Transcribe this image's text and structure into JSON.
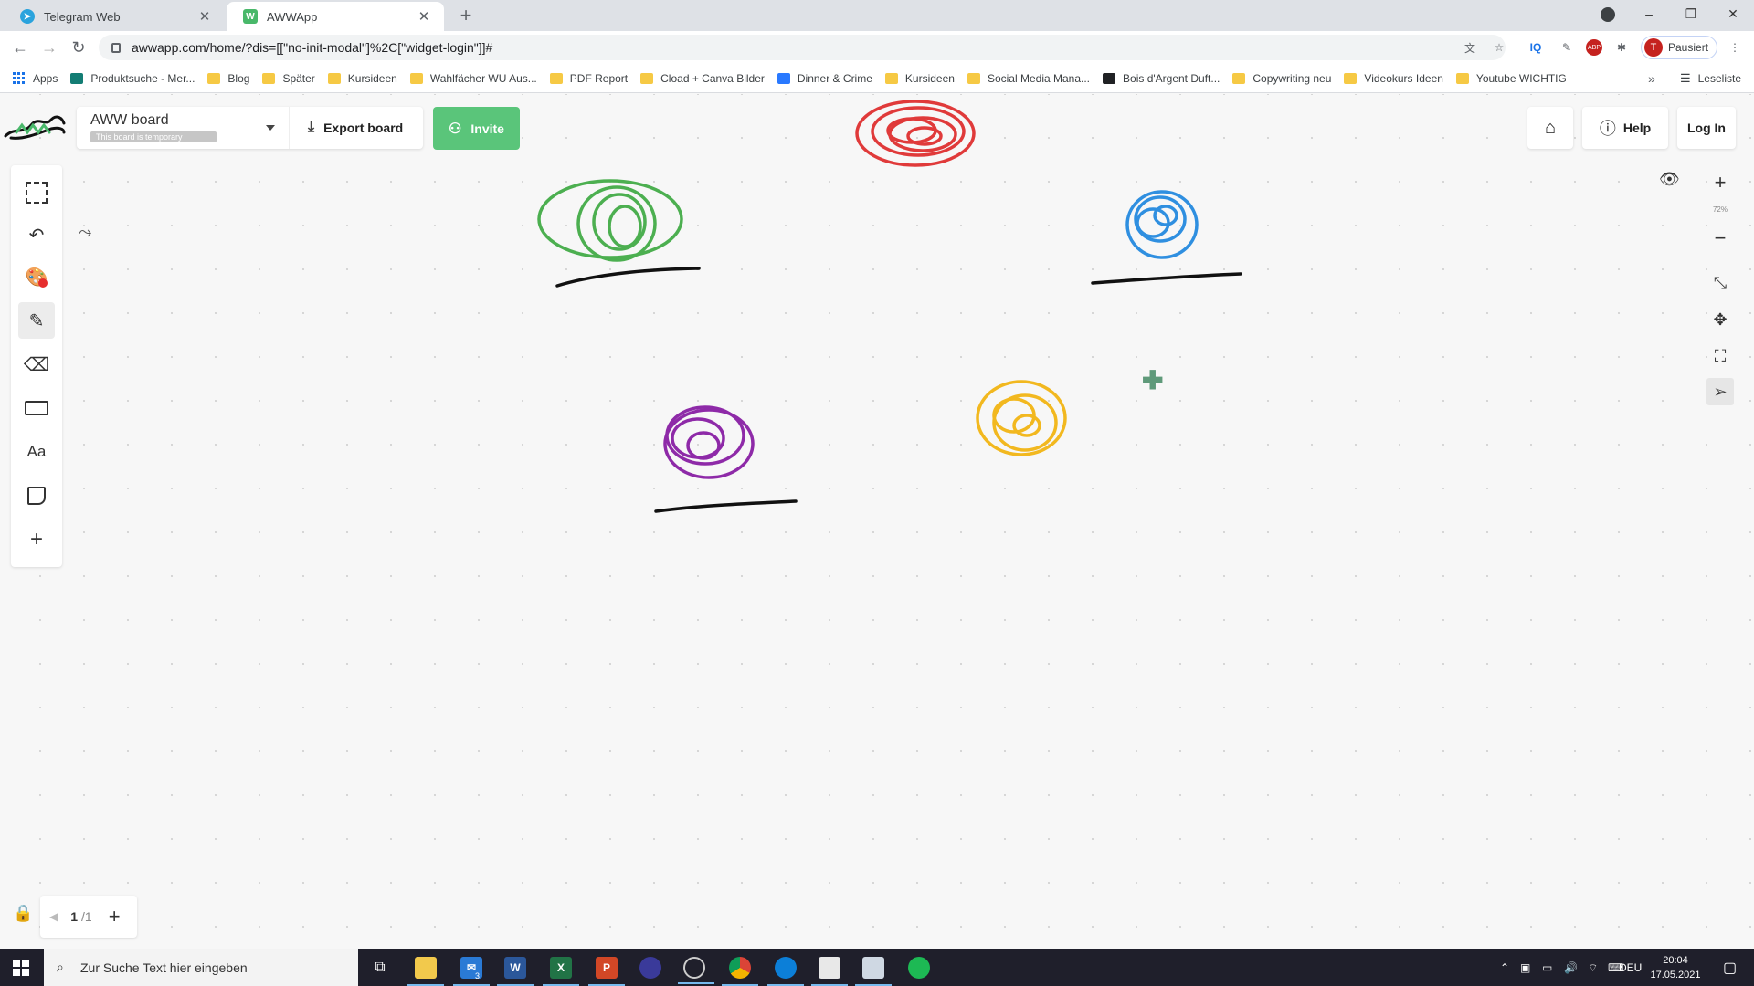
{
  "browser": {
    "tabs": [
      {
        "title": "Telegram Web",
        "active": false
      },
      {
        "title": "AWWApp",
        "active": true
      }
    ],
    "new_tab": "+",
    "url": "awwapp.com/home/?dis=[[\"no-init-modal\"]%2C[\"widget-login\"]]#",
    "window_controls": {
      "minimize": "–",
      "restore": "❐",
      "close": "✕"
    },
    "profile": {
      "initial": "T",
      "label": "Pausiert"
    },
    "bookmarks": [
      {
        "label": "Apps",
        "icon": "apps-grid-icon"
      },
      {
        "label": "Produktsuche - Mer...",
        "icon": "teal-site-icon"
      },
      {
        "label": "Blog",
        "icon": "folder-icon"
      },
      {
        "label": "Später",
        "icon": "folder-icon"
      },
      {
        "label": "Kursideen",
        "icon": "folder-icon"
      },
      {
        "label": "Wahlfächer WU Aus...",
        "icon": "folder-icon"
      },
      {
        "label": "PDF Report",
        "icon": "folder-icon"
      },
      {
        "label": "Cload + Canva Bilder",
        "icon": "folder-icon"
      },
      {
        "label": "Dinner & Crime",
        "icon": "blue-site-icon"
      },
      {
        "label": "Kursideen",
        "icon": "folder-icon"
      },
      {
        "label": "Social Media Mana...",
        "icon": "folder-icon"
      },
      {
        "label": "Bois d'Argent Duft...",
        "icon": "black-site-icon"
      },
      {
        "label": "Copywriting neu",
        "icon": "folder-icon"
      },
      {
        "label": "Videokurs Ideen",
        "icon": "folder-icon"
      },
      {
        "label": "Youtube WICHTIG",
        "icon": "folder-icon"
      }
    ],
    "bookmarks_more": "»",
    "reading_list": "Leseliste"
  },
  "app": {
    "board_name": "AWW board",
    "board_status": "This board is temporary",
    "export_label": "Export board",
    "invite_label": "Invite",
    "help_label": "Help",
    "login_label": "Log In",
    "zoom_level": "72%",
    "page_current": "1",
    "page_total": "/1",
    "colors": {
      "accent": "#5ac57a",
      "active_color_dot": "#e62e2e"
    },
    "drawings": [
      {
        "color": "#e03a3a",
        "shape": "scribble"
      },
      {
        "color": "#4caf50",
        "shape": "scribble"
      },
      {
        "color": "#2f8fe0",
        "shape": "scribble"
      },
      {
        "color": "#8e2aa8",
        "shape": "scribble"
      },
      {
        "color": "#f2b81f",
        "shape": "scribble"
      },
      {
        "color": "#000000",
        "shape": "underline"
      }
    ]
  },
  "taskbar": {
    "search_placeholder": "Zur Suche Text hier eingeben",
    "mail_badge": "3",
    "language": "DEU",
    "time": "20:04",
    "date": "17.05.2021"
  }
}
